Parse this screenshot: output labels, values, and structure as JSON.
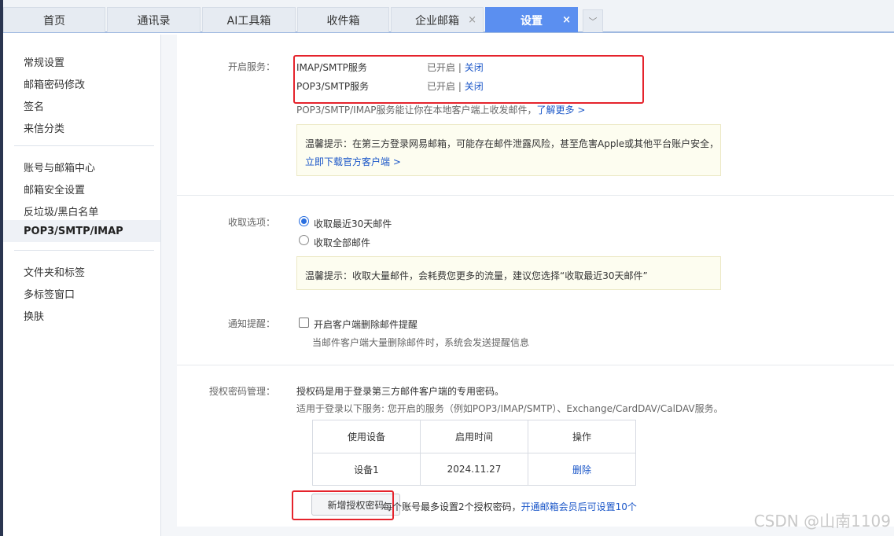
{
  "tabs": [
    {
      "label": "首页",
      "closable": false
    },
    {
      "label": "通讯录",
      "closable": false
    },
    {
      "label": "AI工具箱",
      "closable": false
    },
    {
      "label": "收件箱",
      "closable": false
    },
    {
      "label": "企业邮箱",
      "closable": true
    },
    {
      "label": "设置",
      "closable": true,
      "active": true
    }
  ],
  "tab_close_glyph": "×",
  "tab_more_glyph": "﹀",
  "sidebar": {
    "group1": [
      "常规设置",
      "邮箱密码修改",
      "签名",
      "来信分类"
    ],
    "group2": [
      "账号与邮箱中心",
      "邮箱安全设置",
      "反垃圾/黑白名单",
      "POP3/SMTP/IMAP"
    ],
    "group3": [
      "文件夹和标签",
      "多标签窗口",
      "换肤"
    ],
    "active": "POP3/SMTP/IMAP"
  },
  "services": {
    "label": "开启服务：",
    "rows": [
      {
        "name": "IMAP/SMTP服务",
        "status": "已开启",
        "sep": "|",
        "action": "关闭"
      },
      {
        "name": "POP3/SMTP服务",
        "status": "已开启",
        "sep": "|",
        "action": "关闭"
      }
    ],
    "desc": "POP3/SMTP/IMAP服务能让你在本地客户端上收发邮件，",
    "learn_more": "了解更多 >",
    "tip": "温馨提示：在第三方登录网易邮箱，可能存在邮件泄露风险，甚至危害Apple或其他平台账户安全，",
    "tip_link": "立即下载官方客户端 >"
  },
  "receive": {
    "label": "收取选项：",
    "options": [
      "收取最近30天邮件",
      "收取全部邮件"
    ],
    "selected": 0,
    "tip": "温馨提示：收取大量邮件，会耗费您更多的流量，建议您选择“收取最近30天邮件”"
  },
  "notify": {
    "label": "通知提醒：",
    "checkbox_label": "开启客户端删除邮件提醒",
    "checked": false,
    "desc": "当邮件客户端大量删除邮件时，系统会发送提醒信息"
  },
  "auth": {
    "label": "授权密码管理：",
    "line1": "授权码是用于登录第三方邮件客户端的专用密码。",
    "line2": "适用于登录以下服务: 您开启的服务（例如POP3/IMAP/SMTP）、Exchange/CardDAV/CalDAV服务。",
    "table": {
      "headers": [
        "使用设备",
        "启用时间",
        "操作"
      ],
      "rows": [
        {
          "device": "设备1",
          "time": "2024.11.27",
          "action": "删除"
        }
      ]
    },
    "add_button": "新增授权密码",
    "limit_text": "每个账号最多设置2个授权密码，",
    "vip_link": "开通邮箱会员后可设置10个"
  },
  "watermark": "CSDN @山南1109",
  "colors": {
    "active_tab": "#5b8ff0",
    "link": "#1a56c8",
    "highlight_box": "#e5232c",
    "tip_bg": "#fdfdf0"
  }
}
